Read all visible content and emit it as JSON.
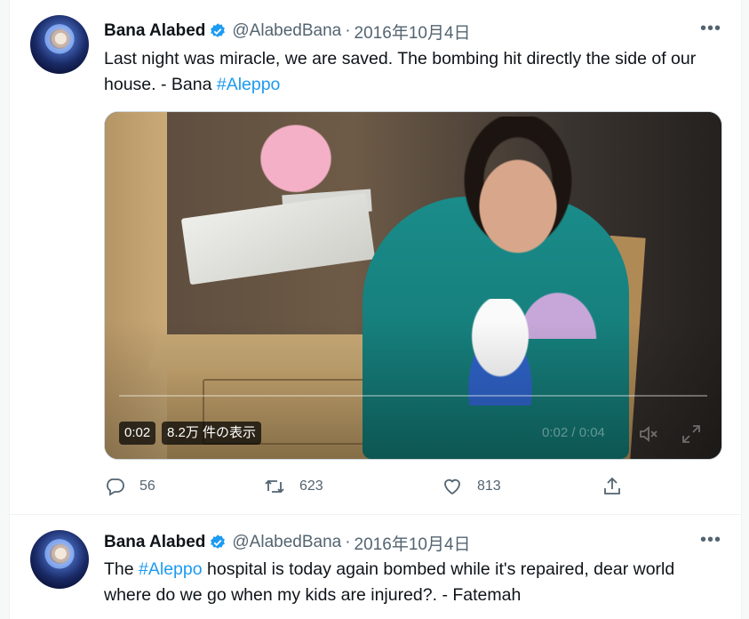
{
  "tweets": [
    {
      "author_name": "Bana Alabed",
      "handle": "@AlabedBana",
      "separator": "·",
      "date": "2016年10月4日",
      "text_before": "Last night was miracle, we are saved. The bombing hit directly the side of our house. - Bana ",
      "hashtag": "#Aleppo",
      "text_after": "",
      "video": {
        "time": "0:02",
        "views": "8.2万 件の表示",
        "position": "0:02 / 0:04",
        "progress": 0.0
      },
      "replies": "56",
      "retweets": "623",
      "likes": "813"
    },
    {
      "author_name": "Bana Alabed",
      "handle": "@AlabedBana",
      "separator": "·",
      "date": "2016年10月4日",
      "text_before": "The ",
      "hashtag": "#Aleppo",
      "text_after": " hospital is today again bombed while it's repaired, dear world where do we go when my kids are injured?. - Fatemah"
    }
  ],
  "icons": {
    "verified": "verified-badge-icon",
    "more": "more-icon",
    "reply": "reply-icon",
    "retweet": "retweet-icon",
    "like": "like-icon",
    "share": "share-icon",
    "mute": "mute-icon",
    "fullscreen": "fullscreen-icon"
  },
  "colors": {
    "accent": "#1d9bf0",
    "secondary_text": "#536471",
    "text": "#0f1419"
  }
}
